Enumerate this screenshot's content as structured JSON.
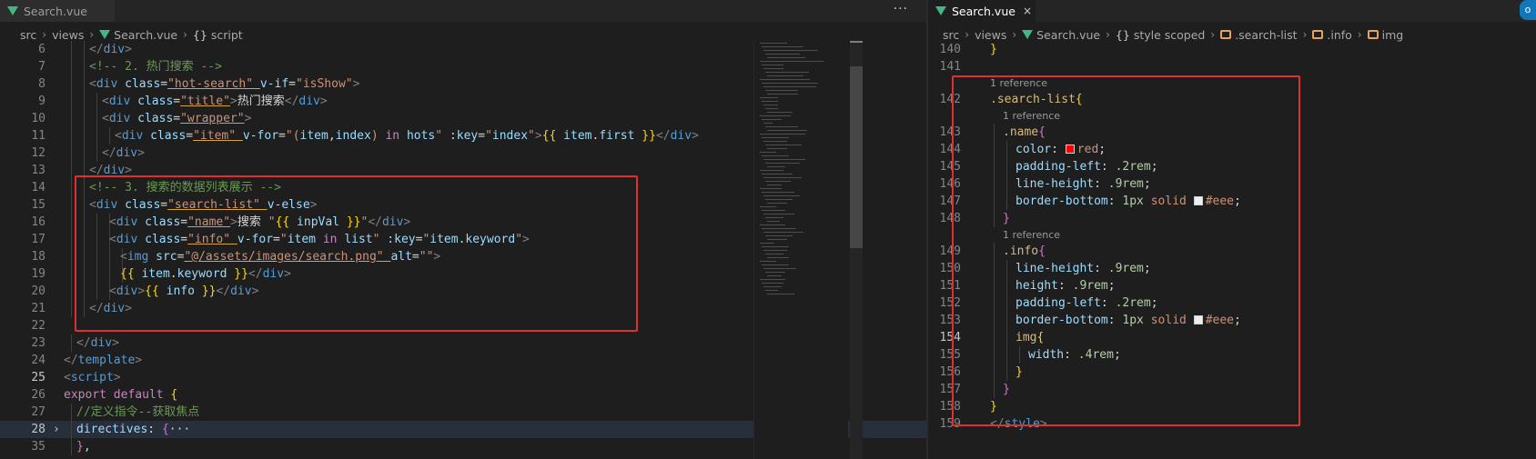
{
  "left_editor": {
    "tab": {
      "label": "Search.vue"
    },
    "more_label": "···",
    "breadcrumb": [
      "src",
      "views",
      "Search.vue",
      "script"
    ],
    "lines": [
      {
        "n": "6",
        "tokens": [
          [
            "t",
            "</"
          ],
          [
            "tg",
            "div"
          ],
          [
            "t",
            ">"
          ]
        ]
      },
      {
        "n": "7",
        "tokens": [
          [
            "cm",
            "<!-- 2. 热门搜索 -->"
          ]
        ]
      },
      {
        "n": "8",
        "tokens": [
          [
            "t",
            "<"
          ],
          [
            "tg",
            "div "
          ],
          [
            "at",
            "class"
          ],
          [
            "tx",
            "="
          ],
          [
            "st",
            "\"hot-search\" "
          ],
          [
            "at",
            "v-if"
          ],
          [
            "tx",
            "="
          ],
          [
            "st",
            "\"isShow\""
          ],
          [
            "t",
            ">"
          ]
        ]
      },
      {
        "n": "9",
        "tokens": [
          [
            "t",
            "<"
          ],
          [
            "tg",
            "div "
          ],
          [
            "at",
            "class"
          ],
          [
            "tx",
            "="
          ],
          [
            "st",
            "\"title\""
          ],
          [
            "t",
            ">"
          ],
          [
            "tx",
            "热门搜索"
          ],
          [
            "t",
            "</"
          ],
          [
            "tg",
            "div"
          ],
          [
            "t",
            ">"
          ]
        ]
      },
      {
        "n": "10",
        "tokens": [
          [
            "t",
            "<"
          ],
          [
            "tg",
            "div "
          ],
          [
            "at",
            "class"
          ],
          [
            "tx",
            "="
          ],
          [
            "st",
            "\"wrapper\""
          ],
          [
            "t",
            ">"
          ]
        ]
      },
      {
        "n": "11",
        "tokens": [
          [
            "t",
            "<"
          ],
          [
            "tg",
            "div "
          ],
          [
            "at",
            "class"
          ],
          [
            "tx",
            "="
          ],
          [
            "st",
            "\"item\" "
          ],
          [
            "at",
            "v-for"
          ],
          [
            "tx",
            "="
          ],
          [
            "st",
            "\"("
          ],
          [
            "vr",
            "item"
          ],
          [
            "tx",
            ","
          ],
          [
            "vr",
            "index"
          ],
          [
            "st",
            ") "
          ],
          [
            "kc",
            "in "
          ],
          [
            "vr",
            "hots"
          ],
          [
            "st",
            "\" "
          ],
          [
            "at",
            ":key"
          ],
          [
            "tx",
            "="
          ],
          [
            "st",
            "\""
          ],
          [
            "vr",
            "index"
          ],
          [
            "st",
            "\""
          ],
          [
            "t",
            ">"
          ],
          [
            "br",
            "{{ "
          ],
          [
            "vr",
            "item"
          ],
          [
            "tx",
            "."
          ],
          [
            "vr",
            "first "
          ],
          [
            "br",
            "}}"
          ],
          [
            "t",
            "</"
          ],
          [
            "tg",
            "div"
          ],
          [
            "t",
            ">"
          ]
        ]
      },
      {
        "n": "12",
        "tokens": [
          [
            "t",
            "</"
          ],
          [
            "tg",
            "div"
          ],
          [
            "t",
            ">"
          ]
        ]
      },
      {
        "n": "13",
        "tokens": [
          [
            "t",
            "</"
          ],
          [
            "tg",
            "div"
          ],
          [
            "t",
            ">"
          ]
        ]
      },
      {
        "n": "14",
        "tokens": [
          [
            "cm",
            "<!-- 3. 搜索的数据列表展示 -->"
          ]
        ]
      },
      {
        "n": "15",
        "tokens": [
          [
            "t",
            "<"
          ],
          [
            "tg",
            "div "
          ],
          [
            "at",
            "class"
          ],
          [
            "tx",
            "="
          ],
          [
            "st",
            "\"search-list\" "
          ],
          [
            "at",
            "v-else"
          ],
          [
            "t",
            ">"
          ]
        ]
      },
      {
        "n": "16",
        "tokens": [
          [
            "t",
            "<"
          ],
          [
            "tg",
            "div "
          ],
          [
            "at",
            "class"
          ],
          [
            "tx",
            "="
          ],
          [
            "st",
            "\"name\""
          ],
          [
            "t",
            ">"
          ],
          [
            "tx",
            "搜索 "
          ],
          [
            "st",
            "\""
          ],
          [
            "br",
            "{{ "
          ],
          [
            "vr",
            "inpVal "
          ],
          [
            "br",
            "}}"
          ],
          [
            "st",
            "\""
          ],
          [
            "t",
            "</"
          ],
          [
            "tg",
            "div"
          ],
          [
            "t",
            ">"
          ]
        ]
      },
      {
        "n": "17",
        "tokens": [
          [
            "t",
            "<"
          ],
          [
            "tg",
            "div "
          ],
          [
            "at",
            "class"
          ],
          [
            "tx",
            "="
          ],
          [
            "st",
            "\"info\" "
          ],
          [
            "at",
            "v-for"
          ],
          [
            "tx",
            "="
          ],
          [
            "st",
            "\""
          ],
          [
            "vr",
            "item "
          ],
          [
            "kc",
            "in "
          ],
          [
            "vr",
            "list"
          ],
          [
            "st",
            "\" "
          ],
          [
            "at",
            ":key"
          ],
          [
            "tx",
            "="
          ],
          [
            "st",
            "\""
          ],
          [
            "vr",
            "item"
          ],
          [
            "tx",
            "."
          ],
          [
            "vr",
            "keyword"
          ],
          [
            "st",
            "\""
          ],
          [
            "t",
            ">"
          ]
        ]
      },
      {
        "n": "18",
        "tokens": [
          [
            "t",
            "<"
          ],
          [
            "tg",
            "img "
          ],
          [
            "at",
            "src"
          ],
          [
            "tx",
            "="
          ],
          [
            "st",
            "\"@/assets/images/search.png\" "
          ],
          [
            "at",
            "alt"
          ],
          [
            "tx",
            "="
          ],
          [
            "st",
            "\"\""
          ],
          [
            "t",
            ">"
          ]
        ]
      },
      {
        "n": "19",
        "tokens": [
          [
            "br",
            "{{ "
          ],
          [
            "vr",
            "item"
          ],
          [
            "tx",
            "."
          ],
          [
            "vr",
            "keyword "
          ],
          [
            "br",
            "}}"
          ],
          [
            "t",
            "</"
          ],
          [
            "tg",
            "div"
          ],
          [
            "t",
            ">"
          ]
        ]
      },
      {
        "n": "20",
        "tokens": [
          [
            "t",
            "<"
          ],
          [
            "tg",
            "div"
          ],
          [
            "t",
            ">"
          ],
          [
            "br",
            "{{ "
          ],
          [
            "vr",
            "info "
          ],
          [
            "br",
            "}}"
          ],
          [
            "t",
            "</"
          ],
          [
            "tg",
            "div"
          ],
          [
            "t",
            ">"
          ]
        ]
      },
      {
        "n": "21",
        "tokens": [
          [
            "t",
            "</"
          ],
          [
            "tg",
            "div"
          ],
          [
            "t",
            ">"
          ]
        ]
      },
      {
        "n": "22",
        "tokens": []
      },
      {
        "n": "23",
        "tokens": [
          [
            "t",
            "</"
          ],
          [
            "tg",
            "div"
          ],
          [
            "t",
            ">"
          ]
        ]
      },
      {
        "n": "24",
        "tokens": [
          [
            "t",
            "</"
          ],
          [
            "tg",
            "template"
          ],
          [
            "t",
            ">"
          ]
        ]
      },
      {
        "n": "25",
        "tokens": [
          [
            "t",
            "<"
          ],
          [
            "tg",
            "script"
          ],
          [
            "t",
            ">"
          ]
        ]
      },
      {
        "n": "26",
        "tokens": [
          [
            "kc",
            "export "
          ],
          [
            "kc",
            "default "
          ],
          [
            "br",
            "{"
          ]
        ]
      },
      {
        "n": "27",
        "tokens": [
          [
            "cm",
            "//定义指令--获取焦点"
          ]
        ]
      },
      {
        "n": "28",
        "tokens": [
          [
            "vr",
            "directives"
          ],
          [
            "tx",
            ": "
          ],
          [
            "bp",
            "{"
          ],
          [
            "tx",
            "···"
          ]
        ]
      },
      {
        "n": "35",
        "tokens": [
          [
            "bp",
            "}"
          ],
          [
            "tx",
            ","
          ]
        ]
      }
    ]
  },
  "right_editor": {
    "tab": {
      "label": "Search.vue",
      "close": "×"
    },
    "badge": "o",
    "breadcrumb": [
      "src",
      "views",
      "Search.vue",
      "style scoped",
      ".search-list",
      ".info",
      "img"
    ],
    "rows": [
      {
        "kind": "line",
        "n": "140",
        "tokens": [
          [
            "br",
            "}"
          ]
        ]
      },
      {
        "kind": "line",
        "n": "141",
        "tokens": []
      },
      {
        "kind": "ref",
        "text": "1 reference"
      },
      {
        "kind": "line",
        "n": "142",
        "tokens": [
          [
            "sel",
            ".search-list"
          ],
          [
            "br",
            "{"
          ]
        ]
      },
      {
        "kind": "ref",
        "text": "1 reference"
      },
      {
        "kind": "line",
        "n": "143",
        "tokens": [
          [
            "sel",
            ".name"
          ],
          [
            "bp",
            "{"
          ]
        ]
      },
      {
        "kind": "line",
        "n": "144",
        "tokens": [
          [
            "vr",
            "color"
          ],
          [
            "tx",
            ": "
          ],
          [
            "swatch",
            "#ff0000"
          ],
          [
            "st",
            "red"
          ],
          [
            "tx",
            ";"
          ]
        ]
      },
      {
        "kind": "line",
        "n": "145",
        "tokens": [
          [
            "vr",
            "padding-left"
          ],
          [
            "tx",
            ": "
          ],
          [
            "num",
            ".2rem"
          ],
          [
            "tx",
            ";"
          ]
        ]
      },
      {
        "kind": "line",
        "n": "146",
        "tokens": [
          [
            "vr",
            "line-height"
          ],
          [
            "tx",
            ": "
          ],
          [
            "num",
            ".9rem"
          ],
          [
            "tx",
            ";"
          ]
        ]
      },
      {
        "kind": "line",
        "n": "147",
        "tokens": [
          [
            "vr",
            "border-bottom"
          ],
          [
            "tx",
            ": "
          ],
          [
            "num",
            "1px "
          ],
          [
            "st",
            "solid "
          ],
          [
            "swatch",
            "#eeeeee"
          ],
          [
            "st",
            "#eee"
          ],
          [
            "tx",
            ";"
          ]
        ]
      },
      {
        "kind": "line",
        "n": "148",
        "tokens": [
          [
            "bp",
            "}"
          ]
        ]
      },
      {
        "kind": "ref",
        "text": "1 reference"
      },
      {
        "kind": "line",
        "n": "149",
        "tokens": [
          [
            "sel",
            ".info"
          ],
          [
            "bp",
            "{"
          ]
        ]
      },
      {
        "kind": "line",
        "n": "150",
        "tokens": [
          [
            "vr",
            "line-height"
          ],
          [
            "tx",
            ": "
          ],
          [
            "num",
            ".9rem"
          ],
          [
            "tx",
            ";"
          ]
        ]
      },
      {
        "kind": "line",
        "n": "151",
        "tokens": [
          [
            "vr",
            "height"
          ],
          [
            "tx",
            ": "
          ],
          [
            "num",
            ".9rem"
          ],
          [
            "tx",
            ";"
          ]
        ]
      },
      {
        "kind": "line",
        "n": "152",
        "tokens": [
          [
            "vr",
            "padding-left"
          ],
          [
            "tx",
            ": "
          ],
          [
            "num",
            ".2rem"
          ],
          [
            "tx",
            ";"
          ]
        ]
      },
      {
        "kind": "line",
        "n": "153",
        "tokens": [
          [
            "vr",
            "border-bottom"
          ],
          [
            "tx",
            ": "
          ],
          [
            "num",
            "1px "
          ],
          [
            "st",
            "solid "
          ],
          [
            "swatch",
            "#eeeeee"
          ],
          [
            "st",
            "#eee"
          ],
          [
            "tx",
            ";"
          ]
        ]
      },
      {
        "kind": "line",
        "n": "154",
        "tokens": [
          [
            "sel",
            "img"
          ],
          [
            "br",
            "{"
          ]
        ],
        "active": true
      },
      {
        "kind": "line",
        "n": "155",
        "tokens": [
          [
            "vr",
            "width"
          ],
          [
            "tx",
            ": "
          ],
          [
            "num",
            ".4rem"
          ],
          [
            "tx",
            ";"
          ]
        ]
      },
      {
        "kind": "line",
        "n": "156",
        "tokens": [
          [
            "br",
            "}"
          ]
        ]
      },
      {
        "kind": "line",
        "n": "157",
        "tokens": [
          [
            "bp",
            "}"
          ]
        ]
      },
      {
        "kind": "line",
        "n": "158",
        "tokens": [
          [
            "br",
            "}"
          ]
        ]
      },
      {
        "kind": "line",
        "n": "159",
        "tokens": [
          [
            "t",
            "</"
          ],
          [
            "tg",
            "style"
          ],
          [
            "t",
            ">"
          ]
        ]
      }
    ]
  },
  "colors": {
    "annotation_box": "#e02f2f",
    "vue_green": "#41b883",
    "editor_bg": "#1e1e1e"
  }
}
